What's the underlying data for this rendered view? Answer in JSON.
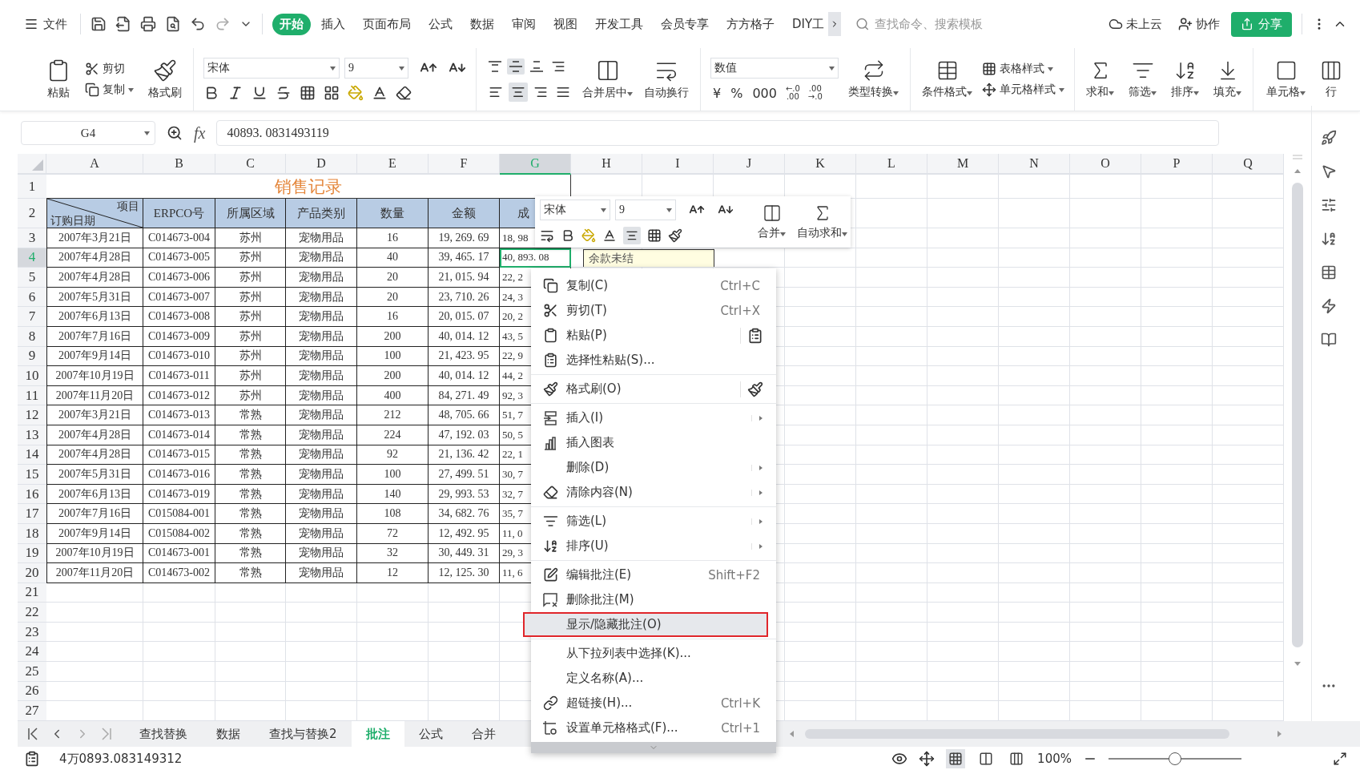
{
  "file_menu": {
    "label": "文件"
  },
  "ribbon_tabs": [
    {
      "label": "开始",
      "selected": true
    },
    {
      "label": "插入",
      "selected": false
    },
    {
      "label": "页面布局",
      "selected": false
    },
    {
      "label": "公式",
      "selected": false
    },
    {
      "label": "数据",
      "selected": false
    },
    {
      "label": "审阅",
      "selected": false
    },
    {
      "label": "视图",
      "selected": false
    },
    {
      "label": "开发工具",
      "selected": false
    },
    {
      "label": "会员专享",
      "selected": false
    },
    {
      "label": "方方格子",
      "selected": false
    },
    {
      "label": "DIY工",
      "selected": false
    }
  ],
  "search": {
    "placeholder": "查找命令、搜索模板"
  },
  "account": {
    "cloud": "未上云",
    "collaborate": "协作",
    "share": "分享"
  },
  "ribbon": {
    "paste": "粘贴",
    "cut": "剪切",
    "copy": "复制",
    "format_painter": "格式刷",
    "font": "宋体",
    "font_size": "9",
    "horizontal_align": [
      {
        "selected": false
      },
      {
        "selected": true
      },
      {
        "selected": false
      },
      {
        "selected": false
      }
    ],
    "vertical_align": [
      {
        "selected": false
      },
      {
        "selected": true
      },
      {
        "selected": false
      }
    ],
    "merge": "合并居中",
    "wrap": "自动换行",
    "number_format": "数值",
    "number_buttons": [
      "¥",
      "%",
      "000"
    ],
    "decimal_buttons": [
      {
        "top": "←.0",
        "bottom": ".00"
      },
      {
        "top": ".00",
        "bottom": "→.0"
      }
    ],
    "convert": "类型转换",
    "conditional": "条件格式",
    "table_style": "表格样式",
    "cell_style": "单元格样式",
    "sum": "求和",
    "filter": "筛选",
    "sort": "排序",
    "fill": "填充",
    "cell": "单元格",
    "row_col": "行"
  },
  "formula_bar": {
    "name_box": "G4",
    "fx": "fx",
    "value": "40893. 0831493119"
  },
  "sheet": {
    "columns": [
      {
        "label": "A",
        "selected": false
      },
      {
        "label": "B",
        "selected": false
      },
      {
        "label": "C",
        "selected": false
      },
      {
        "label": "D",
        "selected": false
      },
      {
        "label": "E",
        "selected": false
      },
      {
        "label": "F",
        "selected": false
      },
      {
        "label": "G",
        "selected": true
      },
      {
        "label": "H",
        "selected": false
      },
      {
        "label": "I",
        "selected": false
      },
      {
        "label": "J",
        "selected": false
      },
      {
        "label": "K",
        "selected": false
      },
      {
        "label": "L",
        "selected": false
      },
      {
        "label": "M",
        "selected": false
      },
      {
        "label": "N",
        "selected": false
      },
      {
        "label": "O",
        "selected": false
      },
      {
        "label": "P",
        "selected": false
      },
      {
        "label": "Q",
        "selected": false
      }
    ],
    "row_numbers": [
      {
        "label": "1",
        "selected": false
      },
      {
        "label": "2",
        "selected": false
      },
      {
        "label": "3",
        "selected": false
      },
      {
        "label": "4",
        "selected": true
      },
      {
        "label": "5",
        "selected": false
      },
      {
        "label": "6",
        "selected": false
      },
      {
        "label": "7",
        "selected": false
      },
      {
        "label": "8",
        "selected": false
      },
      {
        "label": "9",
        "selected": false
      },
      {
        "label": "10",
        "selected": false
      },
      {
        "label": "11",
        "selected": false
      },
      {
        "label": "12",
        "selected": false
      },
      {
        "label": "13",
        "selected": false
      },
      {
        "label": "14",
        "selected": false
      },
      {
        "label": "15",
        "selected": false
      },
      {
        "label": "16",
        "selected": false
      },
      {
        "label": "17",
        "selected": false
      },
      {
        "label": "18",
        "selected": false
      },
      {
        "label": "19",
        "selected": false
      },
      {
        "label": "20",
        "selected": false
      },
      {
        "label": "21",
        "selected": false
      },
      {
        "label": "22",
        "selected": false
      },
      {
        "label": "23",
        "selected": false
      },
      {
        "label": "24",
        "selected": false
      },
      {
        "label": "25",
        "selected": false
      },
      {
        "label": "26",
        "selected": false
      },
      {
        "label": "27",
        "selected": false
      }
    ],
    "title": "销售记录",
    "header": {
      "corner_top": "项目",
      "corner_bottom": "订购日期",
      "cells": [
        "ERPCO号",
        "所属区域",
        "产品类别",
        "数量",
        "金额",
        "成"
      ]
    },
    "rows": [
      {
        "active": false,
        "cells": [
          "2007年3月21日",
          "C014673-004",
          "苏州",
          "宠物用品",
          "16",
          "19, 269. 69",
          "18, 98"
        ]
      },
      {
        "active": true,
        "cells": [
          "2007年4月28日",
          "C014673-005",
          "苏州",
          "宠物用品",
          "40",
          "39, 465. 17",
          "40, 893. 08"
        ]
      },
      {
        "active": false,
        "cells": [
          "2007年4月28日",
          "C014673-006",
          "苏州",
          "宠物用品",
          "20",
          "21, 015. 94",
          "22, 2"
        ]
      },
      {
        "active": false,
        "cells": [
          "2007年5月31日",
          "C014673-007",
          "苏州",
          "宠物用品",
          "20",
          "23, 710. 26",
          "24, 3"
        ]
      },
      {
        "active": false,
        "cells": [
          "2007年6月13日",
          "C014673-008",
          "苏州",
          "宠物用品",
          "16",
          "20, 015. 07",
          "20, 2"
        ]
      },
      {
        "active": false,
        "cells": [
          "2007年7月16日",
          "C014673-009",
          "苏州",
          "宠物用品",
          "200",
          "40, 014. 12",
          "43, 5"
        ]
      },
      {
        "active": false,
        "cells": [
          "2007年9月14日",
          "C014673-010",
          "苏州",
          "宠物用品",
          "100",
          "21, 423. 95",
          "22, 9"
        ]
      },
      {
        "active": false,
        "cells": [
          "2007年10月19日",
          "C014673-011",
          "苏州",
          "宠物用品",
          "200",
          "40, 014. 12",
          "44, 2"
        ]
      },
      {
        "active": false,
        "cells": [
          "2007年11月20日",
          "C014673-012",
          "苏州",
          "宠物用品",
          "400",
          "84, 271. 49",
          "92, 3"
        ]
      },
      {
        "active": false,
        "cells": [
          "2007年3月21日",
          "C014673-013",
          "常熟",
          "宠物用品",
          "212",
          "48, 705. 66",
          "51, 7"
        ]
      },
      {
        "active": false,
        "cells": [
          "2007年4月28日",
          "C014673-014",
          "常熟",
          "宠物用品",
          "224",
          "47, 192. 03",
          "50, 5"
        ]
      },
      {
        "active": false,
        "cells": [
          "2007年4月28日",
          "C014673-015",
          "常熟",
          "宠物用品",
          "92",
          "21, 136. 42",
          "22, 1"
        ]
      },
      {
        "active": false,
        "cells": [
          "2007年5月31日",
          "C014673-016",
          "常熟",
          "宠物用品",
          "100",
          "27, 499. 51",
          "30, 7"
        ]
      },
      {
        "active": false,
        "cells": [
          "2007年6月13日",
          "C014673-019",
          "常熟",
          "宠物用品",
          "140",
          "29, 993. 53",
          "32, 7"
        ]
      },
      {
        "active": false,
        "cells": [
          "2007年7月16日",
          "C015084-001",
          "常熟",
          "宠物用品",
          "108",
          "34, 682. 76",
          "35, 7"
        ]
      },
      {
        "active": false,
        "cells": [
          "2007年9月14日",
          "C015084-002",
          "常熟",
          "宠物用品",
          "72",
          "12, 492. 95",
          "11, 0"
        ]
      },
      {
        "active": false,
        "cells": [
          "2007年10月19日",
          "C014673-001",
          "常熟",
          "宠物用品",
          "32",
          "30, 449. 31",
          "29, 3"
        ]
      },
      {
        "active": false,
        "cells": [
          "2007年11月20日",
          "C014673-002",
          "常熟",
          "宠物用品",
          "12",
          "12, 125. 30",
          "11, 6"
        ]
      }
    ]
  },
  "comment": {
    "text": "余款未结"
  },
  "mini_toolbar": {
    "font": "宋体",
    "font_size": "9",
    "merge": "合并",
    "autosum": "自动求和"
  },
  "context_menu": {
    "groups": [
      [
        {
          "label": "复制(C)",
          "shortcut": "Ctrl+C",
          "submenu": false,
          "selected": false
        },
        {
          "label": "剪切(T)",
          "shortcut": "Ctrl+X",
          "submenu": false,
          "selected": false
        },
        {
          "label": "粘贴(P)",
          "submenu": false,
          "selected": false
        },
        {
          "label": "选择性粘贴(S)...",
          "submenu": false,
          "selected": false
        }
      ],
      [
        {
          "label": "格式刷(O)",
          "submenu": false,
          "selected": false
        }
      ],
      [
        {
          "label": "插入(I)",
          "submenu": true,
          "selected": false
        },
        {
          "label": "插入图表",
          "submenu": false,
          "selected": false
        },
        {
          "label": "删除(D)",
          "submenu": true,
          "selected": false
        },
        {
          "label": "清除内容(N)",
          "submenu": true,
          "selected": false
        }
      ],
      [
        {
          "label": "筛选(L)",
          "submenu": true,
          "selected": false
        },
        {
          "label": "排序(U)",
          "submenu": true,
          "selected": false
        }
      ],
      [
        {
          "label": "编辑批注(E)",
          "shortcut": "Shift+F2",
          "submenu": false,
          "selected": false
        },
        {
          "label": "删除批注(M)",
          "submenu": false,
          "selected": false
        },
        {
          "label": "显示/隐藏批注(O)",
          "submenu": false,
          "selected": true
        }
      ],
      [
        {
          "label": "从下拉列表中选择(K)...",
          "submenu": false,
          "selected": false
        },
        {
          "label": "定义名称(A)...",
          "submenu": false,
          "selected": false
        },
        {
          "label": "超链接(H)...",
          "shortcut": "Ctrl+K",
          "submenu": false,
          "selected": false
        },
        {
          "label": "设置单元格格式(F)...",
          "shortcut": "Ctrl+1",
          "submenu": false,
          "selected": false
        }
      ]
    ]
  },
  "sheet_tabs": [
    {
      "label": "查找替换",
      "selected": false
    },
    {
      "label": "数据",
      "selected": false
    },
    {
      "label": "查找与替换2",
      "selected": false
    },
    {
      "label": "批注",
      "selected": true
    },
    {
      "label": "公式",
      "selected": false
    },
    {
      "label": "合并",
      "selected": false
    }
  ],
  "status_bar": {
    "cell_value": "4万0893.083149312",
    "zoom": "100%",
    "zoom_slider": {
      "level": 0.5
    }
  }
}
